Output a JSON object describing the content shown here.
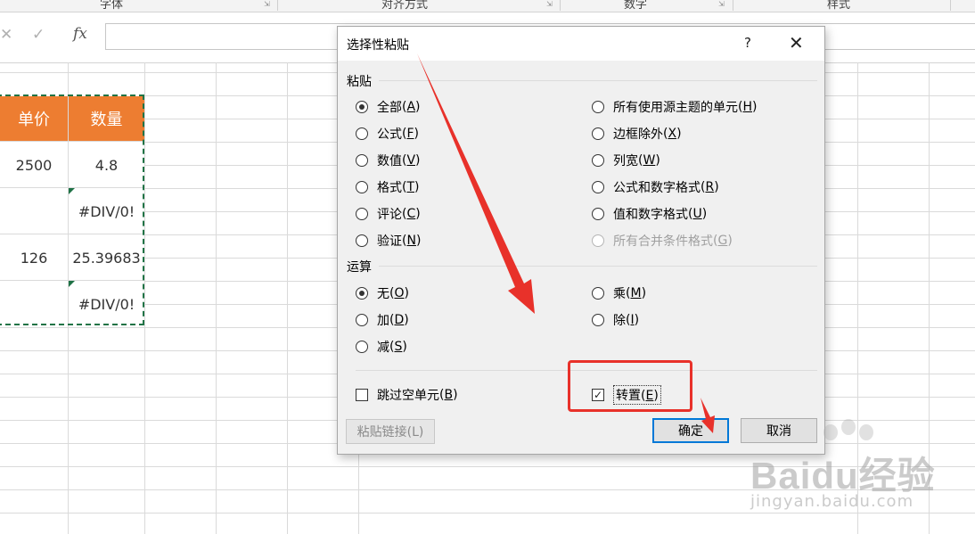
{
  "ribbon": {
    "groups": [
      "字体",
      "对齐方式",
      "数字",
      "样式"
    ]
  },
  "formula_bar": {
    "cancel_glyph": "✕",
    "enter_glyph": "✓",
    "fx_label": "fx",
    "value": ""
  },
  "sheet": {
    "headers": [
      "单价",
      "数量"
    ],
    "rows": [
      [
        "2500",
        "4.8"
      ],
      [
        "",
        "#DIV/0!"
      ],
      [
        "126",
        "25.39683"
      ],
      [
        "",
        "#DIV/0!"
      ]
    ],
    "header_color": "#ed7d31"
  },
  "dialog": {
    "title": "选择性粘贴",
    "help_glyph": "?",
    "close_glyph": "✕",
    "paste_section": "粘贴",
    "paste_options": [
      {
        "text": "全部",
        "key": "A",
        "checked": true,
        "disabled": false
      },
      {
        "text": "公式",
        "key": "F",
        "checked": false,
        "disabled": false
      },
      {
        "text": "数值",
        "key": "V",
        "checked": false,
        "disabled": false
      },
      {
        "text": "格式",
        "key": "T",
        "checked": false,
        "disabled": false
      },
      {
        "text": "评论",
        "key": "C",
        "checked": false,
        "disabled": false
      },
      {
        "text": "验证",
        "key": "N",
        "checked": false,
        "disabled": false
      },
      {
        "text": "所有使用源主题的单元",
        "key": "H",
        "checked": false,
        "disabled": false
      },
      {
        "text": "边框除外",
        "key": "X",
        "checked": false,
        "disabled": false
      },
      {
        "text": "列宽",
        "key": "W",
        "checked": false,
        "disabled": false
      },
      {
        "text": "公式和数字格式",
        "key": "R",
        "checked": false,
        "disabled": false
      },
      {
        "text": "值和数字格式",
        "key": "U",
        "checked": false,
        "disabled": false
      },
      {
        "text": "所有合并条件格式",
        "key": "G",
        "checked": false,
        "disabled": true
      }
    ],
    "operation_section": "运算",
    "operation_options": [
      {
        "text": "无",
        "key": "O",
        "checked": true
      },
      {
        "text": "加",
        "key": "D",
        "checked": false
      },
      {
        "text": "减",
        "key": "S",
        "checked": false
      },
      {
        "text": "乘",
        "key": "M",
        "checked": false
      },
      {
        "text": "除",
        "key": "I",
        "checked": false
      }
    ],
    "skip_blanks": {
      "text": "跳过空单元",
      "key": "B",
      "checked": false
    },
    "transpose": {
      "text": "转置",
      "key": "E",
      "checked": true
    },
    "paste_link_button": "粘贴链接(L)",
    "ok_button": "确定",
    "cancel_button": "取消"
  },
  "annotation_color": "#e8312a",
  "watermark": {
    "logo_text": "Baidu经验",
    "url_text": "jingyan.baidu.com"
  }
}
